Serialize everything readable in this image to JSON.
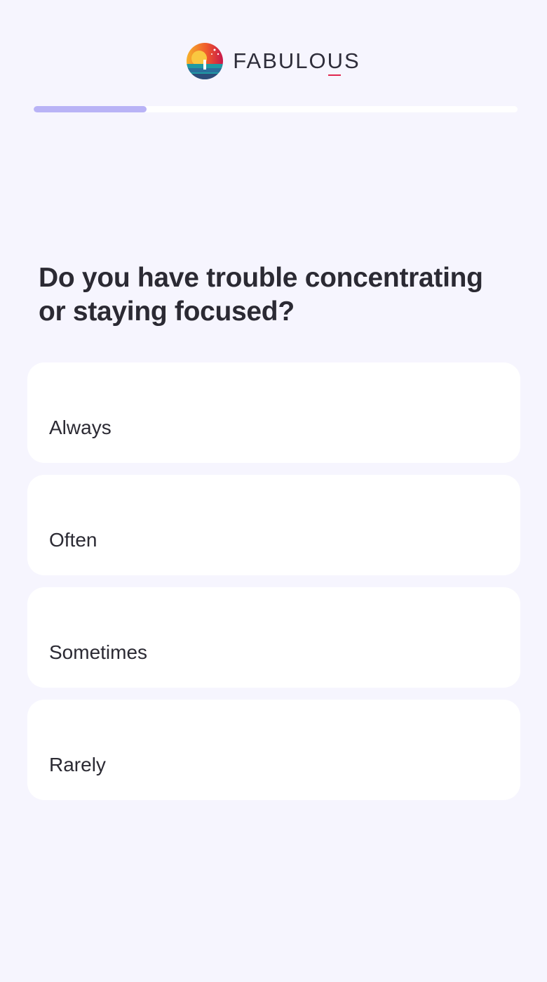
{
  "header": {
    "brand_name": "FABULOUS",
    "logo_icon": "fabulous-sunset-logo-icon"
  },
  "progress": {
    "fraction": 0.234
  },
  "question": {
    "text": "Do you have trouble concentrating or staying focused?"
  },
  "options": [
    {
      "label": "Always"
    },
    {
      "label": "Often"
    },
    {
      "label": "Sometimes"
    },
    {
      "label": "Rarely"
    }
  ],
  "colors": {
    "background": "#f6f5fe",
    "progress_fill": "#b9b3f6",
    "card": "#ffffff",
    "text": "#2b2a33",
    "brand_accent": "#e0264f"
  }
}
